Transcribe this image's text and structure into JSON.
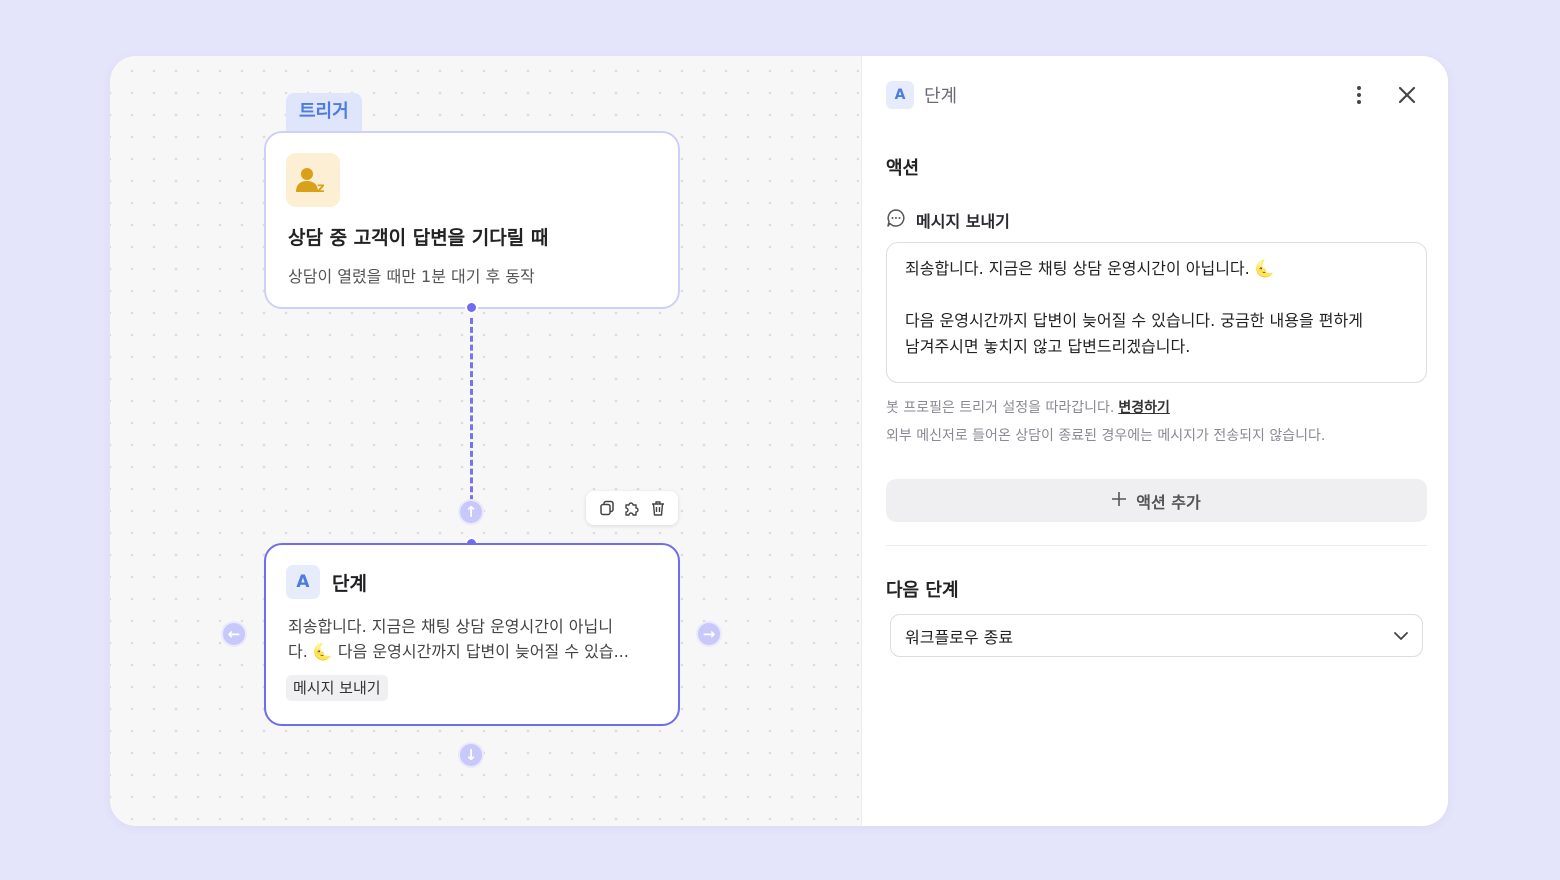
{
  "trigger": {
    "tag": "트리거",
    "title": "상담 중 고객이 답변을 기다릴 때",
    "subtitle": "상담이 열렸을 때만 1분 대기 후 동작"
  },
  "step_node": {
    "badge": "A",
    "title": "단계",
    "preview_line1": "죄송합니다. 지금은 채팅 상담 운영시간이 아닙니",
    "preview_line2": "다. 🌜 다음 운영시간까지 답변이 늦어질 수 있습...",
    "chip": "메시지 보내기"
  },
  "panel": {
    "badge": "A",
    "title": "단계",
    "actions_label": "액션",
    "message_label": "메시지 보내기",
    "message_line1": "죄송합니다. 지금은 채팅 상담 운영시간이 아닙니다. 🌜",
    "message_line2": "다음 운영시간까지 답변이 늦어질 수 있습니다. 궁금한 내용을 편하게",
    "message_line3": "남겨주시면 놓치지 않고 답변드리겠습니다.",
    "note_profile": "봇 프로필은 트리거 설정을 따라갑니다.",
    "note_profile_link": "변경하기",
    "note_external": "외부 메신저로 들어온 상담이 종료된 경우에는 메시지가 전송되지 않습니다.",
    "add_action": "액션 추가",
    "next_step_label": "다음 단계",
    "next_step_value": "워크플로우 종료"
  },
  "colors": {
    "background": "#e4e4fb",
    "accent": "#6e6cf0",
    "badge_blue": "#4d7be0",
    "trigger_icon_bg": "#fcefd4",
    "trigger_icon": "#d9a019"
  },
  "icons": {
    "trigger": "person-sleeping-icon",
    "toolbar": [
      "copy-icon",
      "puzzle-icon",
      "trash-icon"
    ],
    "message": "chat-bubble-icon",
    "add": "plus-icon",
    "select": "chevron-down-icon"
  }
}
